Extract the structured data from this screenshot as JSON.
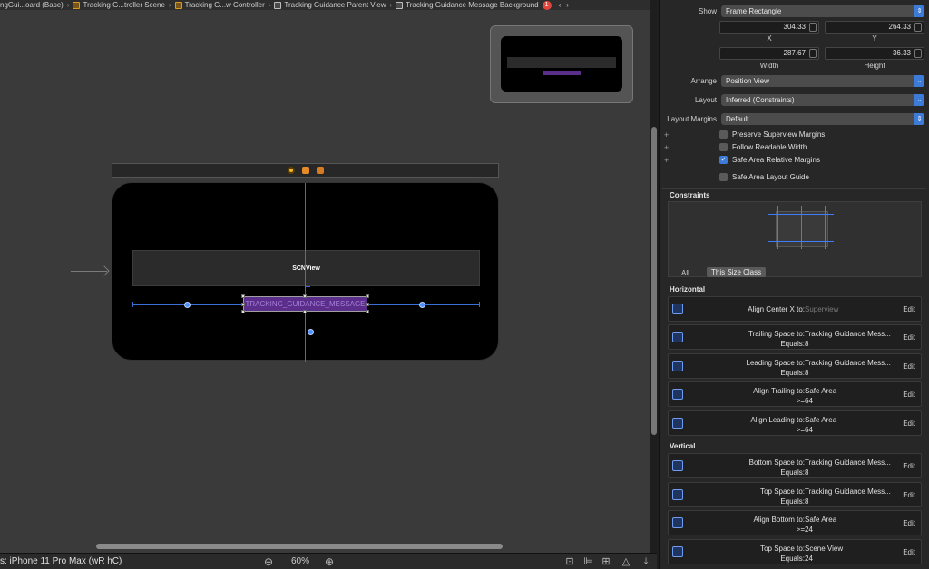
{
  "breadcrumb": {
    "items": [
      "ngGui...oard (Base)",
      "Tracking G...troller Scene",
      "Tracking G...w Controller",
      "Tracking Guidance Parent View",
      "Tracking Guidance Message Background"
    ],
    "warning_count": "1",
    "nav_back": "‹",
    "nav_forward": "›"
  },
  "canvas": {
    "scnview_label": "SCNView",
    "message_label": "TRACKING_GUIDANCE_MESSAGE"
  },
  "status_bar": {
    "device": "s: iPhone 11 Pro Max (wR hC)",
    "zoom_out": "⊖",
    "zoom_level": "60%",
    "zoom_in": "⊕"
  },
  "inspector": {
    "show": {
      "label": "Show",
      "value": "Frame Rectangle"
    },
    "frame": {
      "x": "304.33",
      "y": "264.33",
      "width": "287.67",
      "height": "36.33",
      "x_label": "X",
      "y_label": "Y",
      "width_label": "Width",
      "height_label": "Height"
    },
    "arrange": {
      "label": "Arrange",
      "value": "Position View"
    },
    "layout": {
      "label": "Layout",
      "value": "Inferred (Constraints)"
    },
    "layout_margins": {
      "label": "Layout Margins",
      "value": "Default"
    },
    "checkboxes": [
      {
        "label": "Preserve Superview Margins",
        "checked": false
      },
      {
        "label": "Follow Readable Width",
        "checked": false
      },
      {
        "label": "Safe Area Relative Margins",
        "checked": true
      },
      {
        "label": "Safe Area Layout Guide",
        "checked": false
      }
    ],
    "constraints_title": "Constraints",
    "filter_all": "All",
    "filter_size_class": "This Size Class",
    "horizontal_title": "Horizontal",
    "vertical_title": "Vertical",
    "edit_label": "Edit",
    "horizontal": [
      {
        "name": "Align Center X to:",
        "target": "Superview",
        "relation": "",
        "value": ""
      },
      {
        "name": "Trailing Space to:",
        "target": "Tracking Guidance Mess...",
        "relation": "Equals:",
        "value": "8"
      },
      {
        "name": "Leading Space to:",
        "target": "Tracking Guidance Mess...",
        "relation": "Equals:",
        "value": "8"
      },
      {
        "name": "Align Trailing to:",
        "target": "Safe Area",
        "relation": ">=",
        "value": "64"
      },
      {
        "name": "Align Leading to:",
        "target": "Safe Area",
        "relation": ">=",
        "value": "64"
      }
    ],
    "vertical": [
      {
        "name": "Bottom Space to:",
        "target": "Tracking Guidance Mess...",
        "relation": "Equals:",
        "value": "8"
      },
      {
        "name": "Top Space to:",
        "target": "Tracking Guidance Mess...",
        "relation": "Equals:",
        "value": "8"
      },
      {
        "name": "Align Bottom to:",
        "target": "Safe Area",
        "relation": ">=",
        "value": "24"
      },
      {
        "name": "Top Space to:",
        "target": "Scene View",
        "relation": "Equals:",
        "value": "24"
      }
    ]
  }
}
